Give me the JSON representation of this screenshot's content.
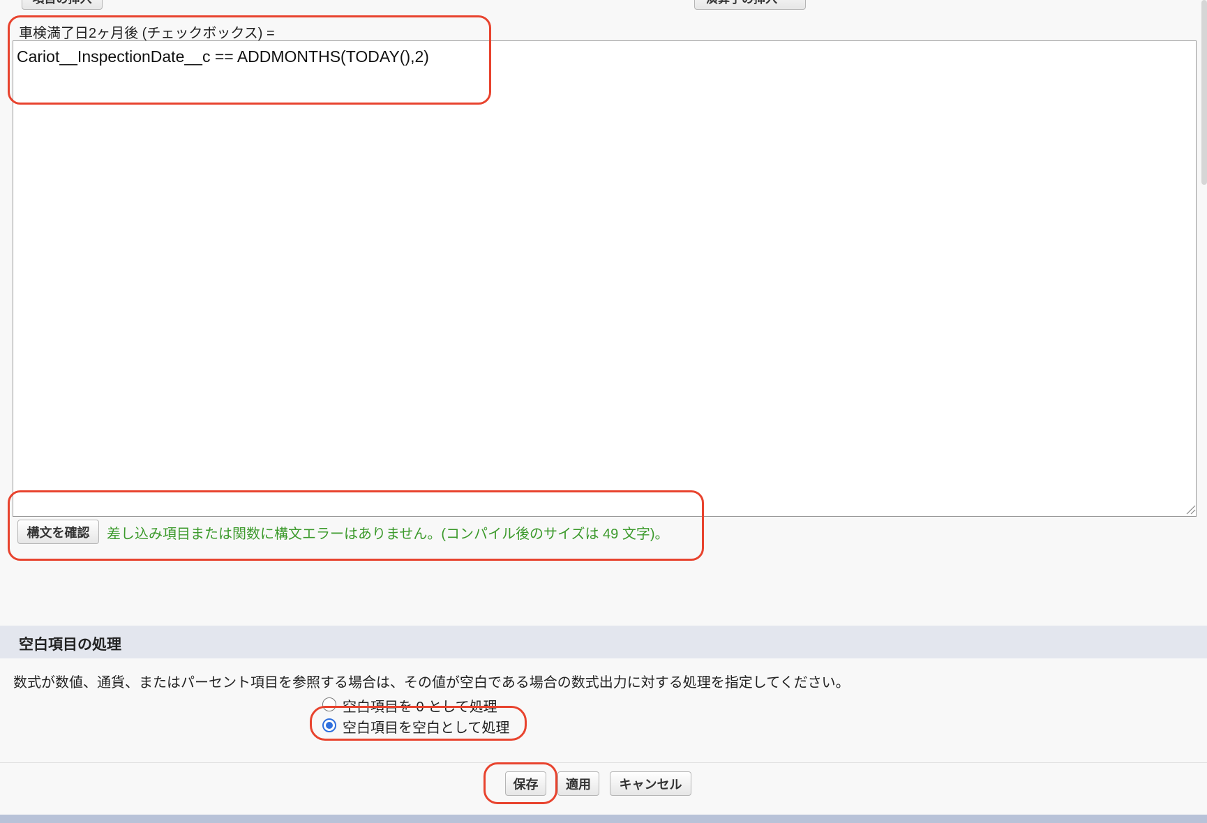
{
  "toolbar": {
    "insert_field_label": "項目の挿入",
    "insert_operator_label": "演算子の挿入"
  },
  "formula": {
    "label": "車検満了日2ヶ月後 (チェックボックス) =",
    "value": "Cariot__InspectionDate__c == ADDMONTHS(TODAY(),2)"
  },
  "syntax": {
    "check_button_label": "構文を確認",
    "message": "差し込み項目または関数に構文エラーはありません。(コンパイル後のサイズは 49 文字)。",
    "message_color": "#3c9a2c"
  },
  "blank_handling": {
    "header": "空白項目の処理",
    "description": "数式が数値、通貨、またはパーセント項目を参照する場合は、その値が空白である場合の数式出力に対する処理を指定してください。",
    "options": [
      {
        "label": "空白項目を 0 として処理",
        "selected": false
      },
      {
        "label": "空白項目を空白として処理",
        "selected": true
      }
    ]
  },
  "footer": {
    "save_label": "保存",
    "apply_label": "適用",
    "cancel_label": "キャンセル"
  },
  "colors": {
    "annotation": "#e8432e",
    "accent": "#2f6fdd",
    "section_header_bg": "#e3e6ee"
  }
}
